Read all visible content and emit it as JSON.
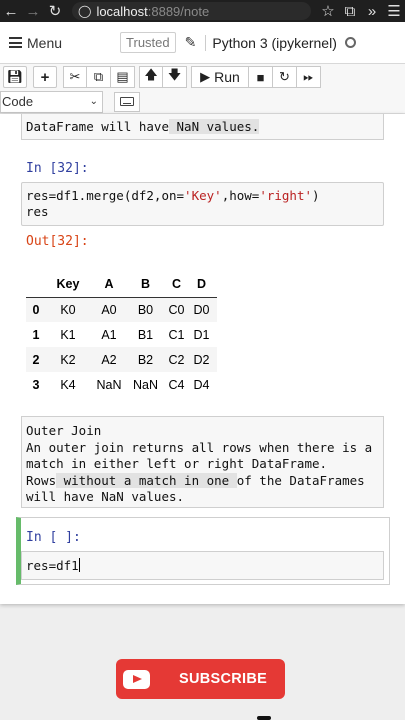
{
  "browser": {
    "url_host": "localhost",
    "url_rest": ":8889/note"
  },
  "header": {
    "menu_label": "Menu",
    "trusted_label": "Trusted",
    "kernel_label": "Python 3 (ipykernel)"
  },
  "toolbar": {
    "run_label": "Run",
    "cell_type": "Code"
  },
  "cells": {
    "md_top_text_a": "DataFrame will have",
    "md_top_text_b": " NaN values.",
    "in32_prompt": "In [32]:",
    "in32_code_line1_a": "res=df1.merge(df2,on=",
    "in32_code_key": "'Key'",
    "in32_code_mid": ",how=",
    "in32_code_right": "'right'",
    "in32_code_end": ")",
    "in32_code_line2": "res",
    "out32_prompt": "Out[32]:",
    "outer_title": "Outer Join",
    "outer_line2": "An outer join returns all rows when there is a",
    "outer_line3": "match in either left or right DataFrame.",
    "outer_line4_a": "Rows",
    "outer_line4_b": " without a match in one ",
    "outer_line4_c": "of the DataFrames",
    "outer_line5": "will have NaN values.",
    "empty_prompt": "In [ ]:",
    "active_code": "res=df1"
  },
  "table": {
    "columns": [
      "",
      "Key",
      "A",
      "B",
      "C",
      "D"
    ],
    "rows": [
      [
        "0",
        "K0",
        "A0",
        "B0",
        "C0",
        "D0"
      ],
      [
        "1",
        "K1",
        "A1",
        "B1",
        "C1",
        "D1"
      ],
      [
        "2",
        "K2",
        "A2",
        "B2",
        "C2",
        "D2"
      ],
      [
        "3",
        "K4",
        "NaN",
        "NaN",
        "C4",
        "D4"
      ]
    ]
  },
  "overlay": {
    "subscribe_label": "SUBSCRIBE"
  }
}
